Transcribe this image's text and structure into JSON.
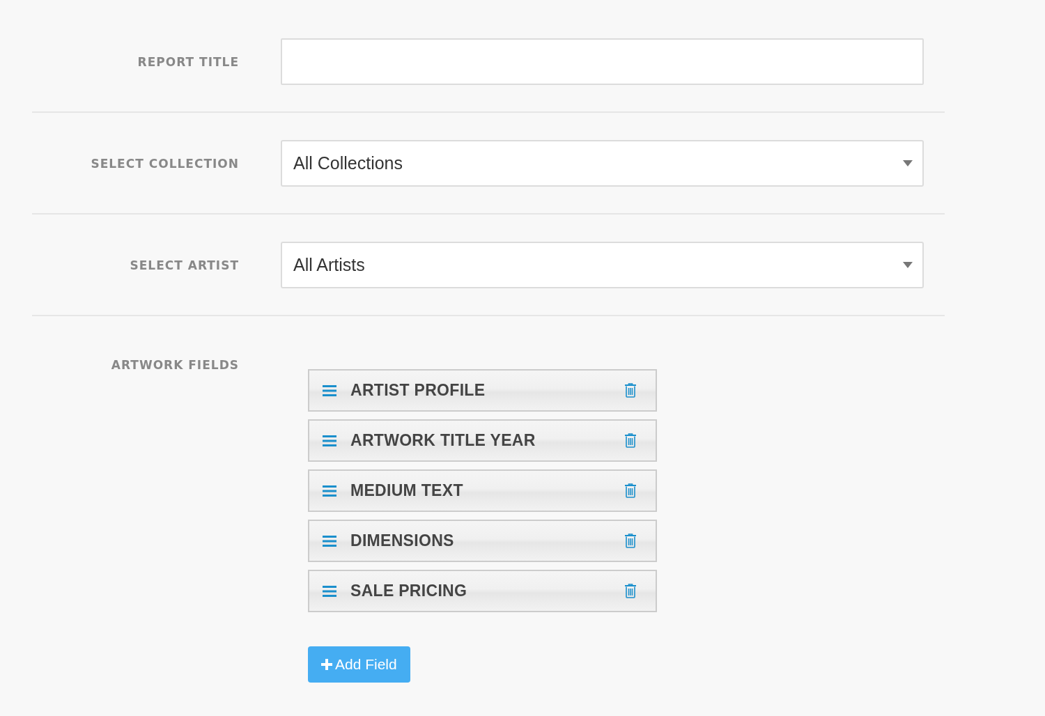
{
  "form": {
    "rows": [
      {
        "kind": "text",
        "label": "REPORT TITLE"
      },
      {
        "kind": "select",
        "label": "SELECT COLLECTION",
        "value": "All Collections"
      },
      {
        "kind": "select",
        "label": "SELECT ARTIST",
        "value": "All Artists"
      }
    ],
    "artwork_fields": {
      "label": "ARTWORK FIELDS",
      "items": [
        "ARTIST PROFILE",
        "ARTWORK TITLE YEAR",
        "MEDIUM TEXT",
        "DIMENSIONS",
        "SALE PRICING"
      ],
      "add_button": "Add Field"
    }
  }
}
